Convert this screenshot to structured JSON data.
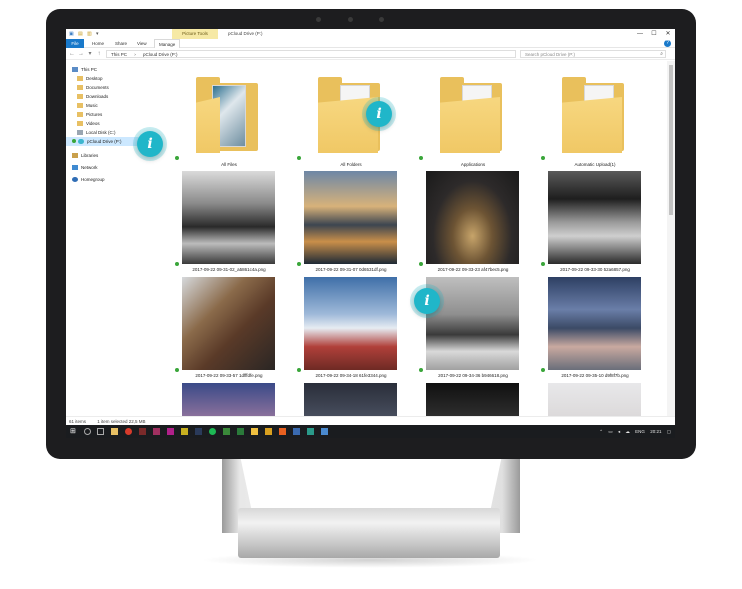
{
  "window": {
    "title": "pCloud Drive (P:)",
    "context_tab": "Picture Tools",
    "controls": [
      "—",
      "☐",
      "✕"
    ]
  },
  "ribbon": {
    "tabs": [
      "File",
      "Home",
      "Share",
      "View",
      "Manage"
    ],
    "active_tab": "Manage"
  },
  "address": {
    "path": [
      "This PC",
      "›",
      "pCloud Drive (P:)"
    ],
    "search_placeholder": "Search pCloud Drive (P:)"
  },
  "nav": {
    "items": [
      {
        "label": "This PC",
        "icon": "computer-icon"
      },
      {
        "label": "Desktop",
        "icon": "folder-icon"
      },
      {
        "label": "Documents",
        "icon": "folder-icon"
      },
      {
        "label": "Downloads",
        "icon": "folder-icon"
      },
      {
        "label": "Music",
        "icon": "folder-icon"
      },
      {
        "label": "Pictures",
        "icon": "folder-icon"
      },
      {
        "label": "Videos",
        "icon": "folder-icon"
      },
      {
        "label": "Local Disk (C:)",
        "icon": "drive-icon"
      },
      {
        "label": "pCloud Drive (P:)",
        "icon": "cloud-drive-icon"
      },
      {
        "label": "Libraries",
        "icon": "library-icon"
      },
      {
        "label": "Network",
        "icon": "network-icon"
      },
      {
        "label": "Homegroup",
        "icon": "homegroup-icon"
      }
    ]
  },
  "folders": [
    {
      "name": "All Files"
    },
    {
      "name": "All Folders"
    },
    {
      "name": "Applications"
    },
    {
      "name": "Automatic Upload(1)"
    }
  ],
  "images": [
    {
      "name": "2017-09-22 09-31-02_a5861c4a.png"
    },
    {
      "name": "2017-09-22 09-31-07 0d6531df.png"
    },
    {
      "name": "2017-09-22 09-33-23 af47bec5.png"
    },
    {
      "name": "2017-09-22 09-33-30 52a6857.png"
    },
    {
      "name": "2017-09-22 09-33-57 1dfffdfe.png"
    },
    {
      "name": "2017-09-22 09-34-18 61fe3344.png"
    },
    {
      "name": "2017-09-22 09-34-36 b946618.png"
    },
    {
      "name": "2017-09-22 09-35-10 d9f8f7b.png"
    }
  ],
  "status": {
    "items": "61 items",
    "selected": "1 item selected 22,5 MB"
  },
  "taskbar": {
    "language": "ENG",
    "time": "20:21"
  },
  "colors": {
    "accent": "#1979ca",
    "marker": "#20b6c9",
    "sync_ok": "#3aa63a"
  }
}
